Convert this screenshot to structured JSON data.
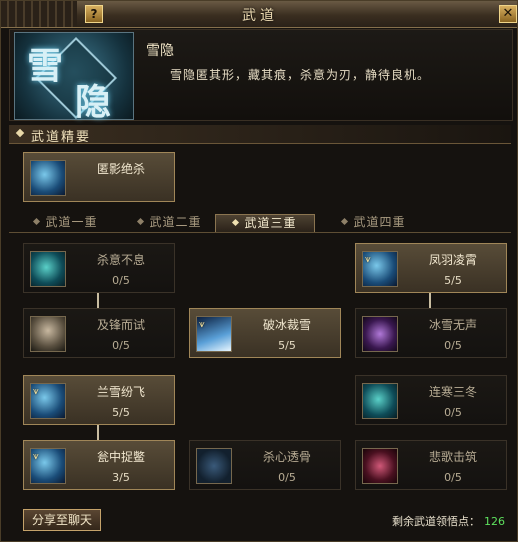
{
  "window": {
    "title": "武道",
    "help_label": "?",
    "close_label": "✕"
  },
  "header": {
    "emblem_chars": [
      "雪",
      "隐"
    ],
    "skill_name": "雪隐",
    "description": "雪隐匿其形，藏其痕，杀意为刃，静待良机。"
  },
  "essentials": {
    "title": "武道精要",
    "skill": {
      "name": "匿影绝杀",
      "icon": "shadow-assassin-icon"
    }
  },
  "tabs": [
    {
      "label": "武道一重",
      "active": false
    },
    {
      "label": "武道二重",
      "active": false
    },
    {
      "label": "武道三重",
      "active": true
    },
    {
      "label": "武道四重",
      "active": false
    }
  ],
  "skills": {
    "r1c1": {
      "name": "杀意不息",
      "value": "0/5",
      "icon": "moon-blade-icon"
    },
    "r1c3": {
      "name": "凤羽凌霄",
      "value": "5/5",
      "icon": "phoenix-feather-icon"
    },
    "r2c1": {
      "name": "及锋而试",
      "value": "0/5",
      "icon": "warrior-face-icon"
    },
    "r2c2": {
      "name": "破冰裁雪",
      "value": "5/5",
      "icon": "ice-shatter-icon"
    },
    "r2c3": {
      "name": "冰雪无声",
      "value": "0/5",
      "icon": "silent-frost-icon"
    },
    "r3c1": {
      "name": "兰雪纷飞",
      "value": "5/5",
      "icon": "snow-slash-icon"
    },
    "r3c3": {
      "name": "连寒三冬",
      "value": "0/5",
      "icon": "winter-chain-icon"
    },
    "r4c1": {
      "name": "瓮中捉鳖",
      "value": "3/5",
      "icon": "trap-strike-icon"
    },
    "r4c2": {
      "name": "杀心透骨",
      "value": "0/5",
      "icon": "piercing-heart-icon"
    },
    "r4c3": {
      "name": "悲歌击筑",
      "value": "0/5",
      "icon": "mourning-song-icon"
    }
  },
  "footer": {
    "share_label": "分享至聊天",
    "points_label": "剩余武道领悟点：",
    "points_value": "126"
  },
  "colors": {
    "accent_gold": "#c4a26a",
    "points_green": "#5ee05e",
    "title_text": "#ead8b0"
  }
}
